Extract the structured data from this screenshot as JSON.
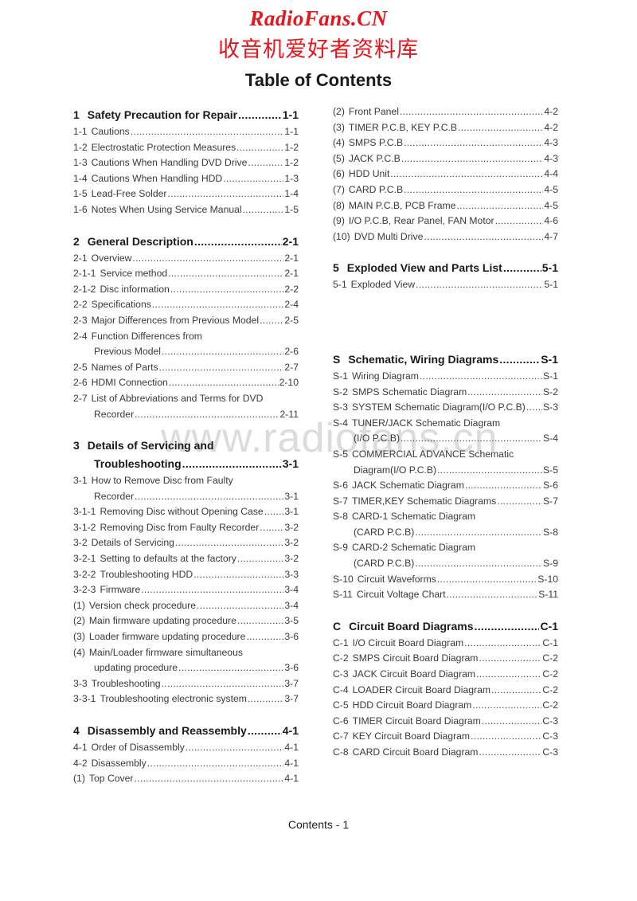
{
  "brand": {
    "name_en": "RadioFans.CN",
    "name_cn": "收音机爱好者资料库",
    "accent_color": "#e8141c"
  },
  "watermark": "www.radiofans.cn",
  "title": "Table of Contents",
  "left_column": [
    {
      "num": "1",
      "label": "Safety Precaution for Repair",
      "page": "1-1",
      "head": true
    },
    {
      "num": "1-1",
      "label": "Cautions",
      "page": "1-1"
    },
    {
      "num": "1-2",
      "label": "Electrostatic Protection Measures",
      "page": "1-2"
    },
    {
      "num": "1-3",
      "label": "Cautions When Handling DVD Drive",
      "page": "1-2"
    },
    {
      "num": "1-4",
      "label": "Cautions When Handling HDD",
      "page": "1-3"
    },
    {
      "num": "1-5",
      "label": "Lead-Free Solder",
      "page": "1-4"
    },
    {
      "num": "1-6",
      "label": "Notes When Using Service Manual",
      "page": "1-5"
    },
    {
      "gap": true
    },
    {
      "num": "2",
      "label": "General Description",
      "page": "2-1",
      "head": true
    },
    {
      "num": "2-1",
      "label": "Overview",
      "page": "2-1"
    },
    {
      "num": "2-1-1",
      "label": "Service method",
      "page": "2-1"
    },
    {
      "num": "2-1-2",
      "label": "Disc information",
      "page": "2-2"
    },
    {
      "num": "2-2",
      "label": "Specifications",
      "page": "2-4"
    },
    {
      "num": "2-3",
      "label": "Major Differences from Previous Model",
      "page": "2-5"
    },
    {
      "num": "2-4",
      "label": "Function Differences from",
      "page": "",
      "nodots": true
    },
    {
      "num": "",
      "label": "Previous Model",
      "page": "2-6",
      "indent": true
    },
    {
      "num": "2-5",
      "label": "Names of Parts",
      "page": "2-7"
    },
    {
      "num": "2-6",
      "label": "HDMI Connection",
      "page": "2-10"
    },
    {
      "num": "2-7",
      "label": "List of Abbreviations and Terms for DVD",
      "page": "",
      "nodots": true
    },
    {
      "num": "",
      "label": "Recorder",
      "page": "2-11",
      "indent": true
    },
    {
      "gap": true
    },
    {
      "num": "3",
      "label": "Details of Servicing and",
      "page": "",
      "head": true,
      "nodots": true
    },
    {
      "num": "",
      "label": "Troubleshooting",
      "page": "3-1",
      "head": true,
      "indent": true
    },
    {
      "num": "3-1",
      "label": "How to Remove Disc from Faulty",
      "page": "",
      "nodots": true
    },
    {
      "num": "",
      "label": "Recorder",
      "page": "3-1",
      "indent": true
    },
    {
      "num": "3-1-1",
      "label": "Removing Disc without Opening Case",
      "page": "3-1"
    },
    {
      "num": "3-1-2",
      "label": "Removing Disc from Faulty Recorder",
      "page": "3-2"
    },
    {
      "num": "3-2",
      "label": "Details of Servicing",
      "page": "3-2"
    },
    {
      "num": "3-2-1",
      "label": "Setting to defaults at the factory",
      "page": "3-2"
    },
    {
      "num": "3-2-2",
      "label": "Troubleshooting HDD",
      "page": "3-3"
    },
    {
      "num": "3-2-3",
      "label": "Firmware",
      "page": "3-4"
    },
    {
      "num": "(1)",
      "label": "Version check procedure",
      "page": "3-4"
    },
    {
      "num": "(2)",
      "label": "Main firmware updating procedure",
      "page": "3-5"
    },
    {
      "num": "(3)",
      "label": "Loader firmware updating procedure",
      "page": "3-6"
    },
    {
      "num": "(4)",
      "label": "Main/Loader firmware simultaneous",
      "page": "",
      "nodots": true
    },
    {
      "num": "",
      "label": "updating procedure",
      "page": "3-6",
      "indent": true
    },
    {
      "num": "3-3",
      "label": "Troubleshooting",
      "page": "3-7"
    },
    {
      "num": "3-3-1",
      "label": "Troubleshooting electronic system",
      "page": "3-7"
    },
    {
      "gap": true
    },
    {
      "num": "4",
      "label": "Disassembly and Reassembly",
      "page": "4-1",
      "head": true
    },
    {
      "num": "4-1",
      "label": "Order of Disassembly",
      "page": "4-1"
    },
    {
      "num": "4-2",
      "label": "Disassembly",
      "page": "4-1"
    },
    {
      "num": "(1)",
      "label": "Top Cover",
      "page": "4-1"
    }
  ],
  "right_column": [
    {
      "num": "(2)",
      "label": "Front Panel",
      "page": "4-2"
    },
    {
      "num": "(3)",
      "label": "TIMER P.C.B, KEY P.C.B",
      "page": "4-2"
    },
    {
      "num": "(4)",
      "label": "SMPS P.C.B",
      "page": "4-3"
    },
    {
      "num": "(5)",
      "label": "JACK P.C.B",
      "page": "4-3"
    },
    {
      "num": "(6)",
      "label": "HDD Unit",
      "page": "4-4"
    },
    {
      "num": "(7)",
      "label": "CARD P.C.B",
      "page": "4-5"
    },
    {
      "num": "(8)",
      "label": "MAIN P.C.B, PCB Frame",
      "page": "4-5"
    },
    {
      "num": "(9)",
      "label": "I/O P.C.B, Rear Panel, FAN Motor",
      "page": "4-6"
    },
    {
      "num": "(10)",
      "label": "DVD Multi Drive",
      "page": "4-7"
    },
    {
      "gap": true
    },
    {
      "num": "5",
      "label": "Exploded View and Parts List",
      "page": "5-1",
      "head": true
    },
    {
      "num": "5-1",
      "label": "Exploded View",
      "page": "5-1"
    },
    {
      "gapxl": true
    },
    {
      "num": "S",
      "label": "Schematic, Wiring Diagrams",
      "page": "S-1",
      "head": true
    },
    {
      "num": "S-1",
      "label": "Wiring Diagram",
      "page": "S-1"
    },
    {
      "num": "S-2",
      "label": "SMPS Schematic Diagram",
      "page": "S-2"
    },
    {
      "num": "S-3",
      "label": "SYSTEM Schematic Diagram(I/O P.C.B)",
      "page": "S-3"
    },
    {
      "num": "S-4",
      "label": "TUNER/JACK Schematic Diagram",
      "page": "",
      "nodots": true
    },
    {
      "num": "",
      "label": "(I/O P.C.B)",
      "page": "S-4",
      "indent": true
    },
    {
      "num": "S-5",
      "label": "COMMERCIAL ADVANCE Schematic",
      "page": "",
      "nodots": true
    },
    {
      "num": "",
      "label": "Diagram(I/O P.C.B)",
      "page": "S-5",
      "indent": true
    },
    {
      "num": "S-6",
      "label": "JACK Schematic Diagram",
      "page": "S-6"
    },
    {
      "num": "S-7",
      "label": "TIMER,KEY Schematic Diagrams",
      "page": "S-7"
    },
    {
      "num": "S-8",
      "label": "CARD-1 Schematic Diagram",
      "page": "",
      "nodots": true
    },
    {
      "num": "",
      "label": "(CARD P.C.B)",
      "page": "S-8",
      "indent": true
    },
    {
      "num": "S-9",
      "label": "CARD-2 Schematic Diagram",
      "page": "",
      "nodots": true
    },
    {
      "num": "",
      "label": "(CARD P.C.B)",
      "page": "S-9",
      "indent": true
    },
    {
      "num": "S-10",
      "label": "Circuit Waveforms",
      "page": "S-10"
    },
    {
      "num": "S-11",
      "label": "Circuit Voltage Chart",
      "page": "S-11"
    },
    {
      "gap": true
    },
    {
      "num": "C",
      "label": "Circuit Board Diagrams",
      "page": "C-1",
      "head": true
    },
    {
      "num": "C-1",
      "label": "I/O Circuit Board Diagram",
      "page": "C-1"
    },
    {
      "num": "C-2",
      "label": "SMPS Circuit Board Diagram",
      "page": "C-2"
    },
    {
      "num": "C-3",
      "label": "JACK Circuit Board Diagram",
      "page": "C-2"
    },
    {
      "num": "C-4",
      "label": "LOADER Circuit Board Diagram",
      "page": "C-2"
    },
    {
      "num": "C-5",
      "label": "HDD Circuit Board Diagram",
      "page": "C-2"
    },
    {
      "num": "C-6",
      "label": "TIMER Circuit Board Diagram",
      "page": "C-3"
    },
    {
      "num": "C-7",
      "label": "KEY Circuit Board Diagram",
      "page": "C-3"
    },
    {
      "num": "C-8",
      "label": "CARD Circuit Board Diagram",
      "page": "C-3"
    }
  ],
  "footer": "Contents - 1"
}
